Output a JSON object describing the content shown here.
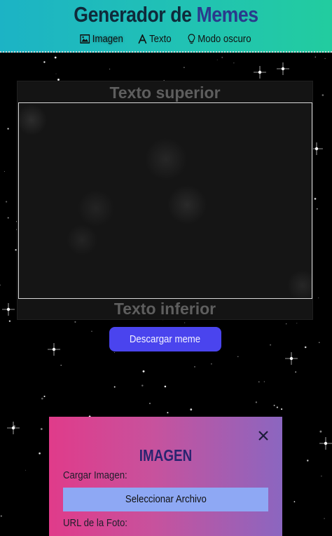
{
  "header": {
    "title_part1": "Generador de",
    "title_part2": "Memes",
    "nav": [
      {
        "label": "Imagen",
        "icon": "image-icon"
      },
      {
        "label": "Texto",
        "icon": "text-icon"
      },
      {
        "label": "Modo oscuro",
        "icon": "lightbulb-icon"
      }
    ]
  },
  "meme": {
    "top_text": "Texto superior",
    "bottom_text": "Texto inferior"
  },
  "download_button": "Descargar meme",
  "panel": {
    "title": "IMAGEN",
    "upload_label": "Cargar Imagen:",
    "file_button": "Seleccionar Archivo",
    "url_label": "URL de la Foto:",
    "close_icon": "close-icon"
  },
  "colors": {
    "header_gradient_start": "#1cb3c5",
    "header_gradient_end": "#22cc9f",
    "download_button": "#4a44ee",
    "panel_gradient_start": "#e03b8a",
    "panel_gradient_end": "#8b66c0",
    "file_button": "#8ea8f4"
  }
}
